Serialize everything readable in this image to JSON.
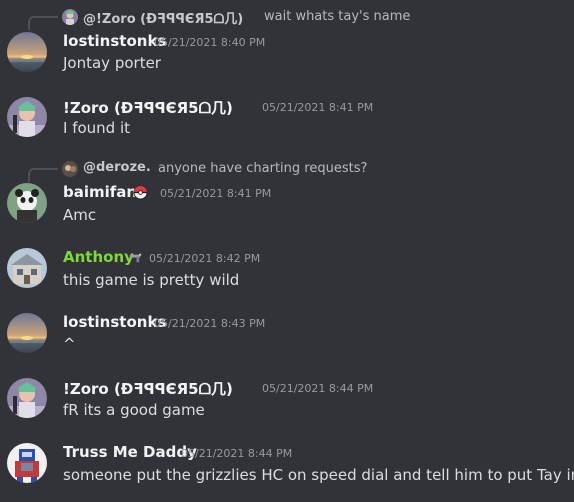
{
  "messages": [
    {
      "reply": {
        "name": "@!Zoro (ĐꟻꟼꟼЄЯ5ᗝ几)",
        "text": "wait whats tay's name"
      },
      "author": "lostinstonks",
      "timestamp": "05/21/2021 8:40 PM",
      "text": "Jontay porter",
      "avatar_icon": "sunset-avatar",
      "name_color": "#f2f3f5"
    },
    {
      "author": "!Zoro (ĐꟻꟼꟼЄЯ5ᗝ几)",
      "timestamp": "05/21/2021 8:41 PM",
      "text": "I found it",
      "avatar_icon": "anime-character-avatar",
      "name_color": "#f2f3f5"
    },
    {
      "reply": {
        "name": "@deroze.",
        "text": "anyone have charting requests?"
      },
      "author": "baimifan",
      "timestamp": "05/21/2021 8:41 PM",
      "text": "Amc",
      "avatar_icon": "panda-avatar",
      "badge_icon": "pokeball-icon",
      "name_color": "#f2f3f5"
    },
    {
      "author": "Anthony",
      "timestamp": "05/21/2021 8:42 PM",
      "text": "this game is pretty wild",
      "avatar_icon": "house-avatar",
      "badge_icon": "gun-icon",
      "name_color": "#7fd93a"
    },
    {
      "author": "lostinstonks",
      "timestamp": "05/21/2021 8:43 PM",
      "text": "^",
      "avatar_icon": "sunset-avatar",
      "name_color": "#f2f3f5"
    },
    {
      "author": "!Zoro (ĐꟻꟼꟼЄЯ5ᗝ几)",
      "timestamp": "05/21/2021 8:44 PM",
      "text": "fR its a good game",
      "avatar_icon": "anime-character-avatar",
      "name_color": "#f2f3f5"
    },
    {
      "author": "Truss Me Daddy",
      "timestamp": "05/21/2021 8:44 PM",
      "text": "someone put the grizzlies HC on speed dial and tell him to put Tay in",
      "avatar_icon": "robot-avatar",
      "name_color": "#f2f3f5"
    }
  ],
  "colors": {
    "background": "#313338",
    "username": "#f2f3f5",
    "timestamp": "#949ba4",
    "message_text": "#dbdee1",
    "anthony_role": "#7fd93a"
  }
}
